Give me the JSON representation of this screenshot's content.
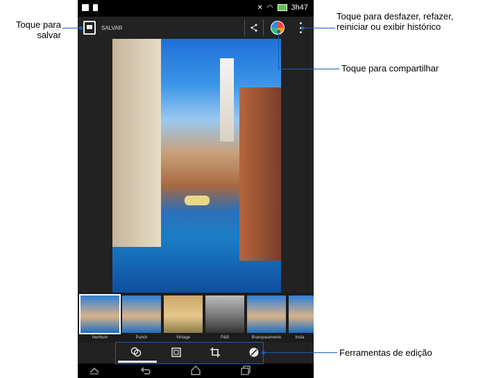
{
  "statusbar": {
    "time": "3h47"
  },
  "actionbar": {
    "save_label": "SALVAR"
  },
  "filters": [
    {
      "label": "Nenhum"
    },
    {
      "label": "Punch"
    },
    {
      "label": "Vintage"
    },
    {
      "label": "P&B"
    },
    {
      "label": "Branqueamento"
    },
    {
      "label": "Insta"
    }
  ],
  "callouts": {
    "save_line1": "Toque para",
    "save_line2": "salvar",
    "undo_line1": "Toque para desfazer, refazer,",
    "undo_line2": "reiniciar ou exibir histórico",
    "share": "Toque para compartilhar",
    "tools": "Ferramentas de edição"
  },
  "icons": {
    "share": "share-icon",
    "palette": "palette-icon",
    "overflow": "overflow-menu-icon",
    "filters_tool": "filters-tool-icon",
    "frame_tool": "frame-tool-icon",
    "crop_tool": "crop-tool-icon",
    "adjust_tool": "adjust-tool-icon",
    "back": "back-icon",
    "home": "home-icon",
    "recents": "recents-icon",
    "nav_up": "collapse-icon"
  }
}
